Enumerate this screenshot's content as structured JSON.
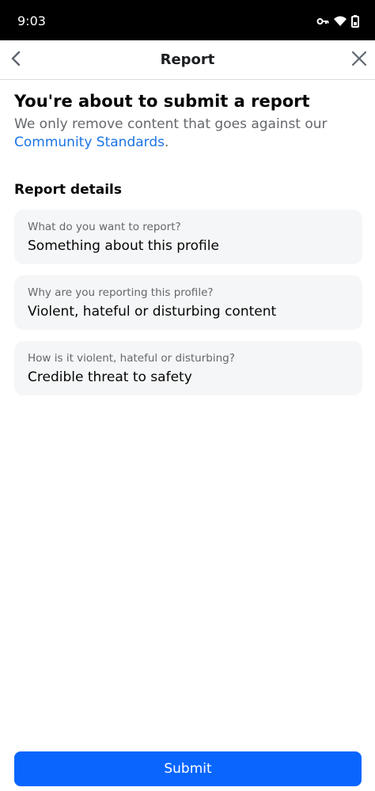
{
  "status_bar": {
    "time": "9:03",
    "icons": [
      "key-icon",
      "wifi-icon",
      "battery-icon"
    ]
  },
  "app_bar": {
    "title": "Report",
    "back_icon": "chevron-left-icon",
    "close_icon": "close-icon"
  },
  "intro": {
    "headline": "You're about to submit a report",
    "subtext_prefix": "We only remove content that goes against our ",
    "link_text": "Community Standards",
    "subtext_suffix": "."
  },
  "details": {
    "section_title": "Report details",
    "items": [
      {
        "label": "What do you want to report?",
        "value": "Something about this profile"
      },
      {
        "label": "Why are you reporting this profile?",
        "value": "Violent, hateful or disturbing content"
      },
      {
        "label": "How is it violent, hateful or disturbing?",
        "value": "Credible threat to safety"
      }
    ]
  },
  "submit": {
    "label": "Submit"
  },
  "colors": {
    "accent": "#0866ff",
    "link": "#1b74e4",
    "card_bg": "#f5f6f7"
  }
}
